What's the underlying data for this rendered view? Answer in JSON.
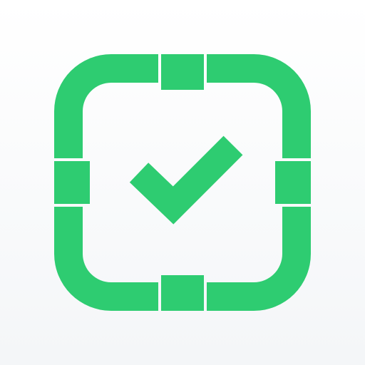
{
  "icon": {
    "name": "verified-checkbox-app-icon",
    "accent_color": "#2ECC71",
    "background_top": "#FFFFFF",
    "background_bottom": "#F4F6F8",
    "glyphs": [
      "rounded-square-frame-icon",
      "checkmark-icon"
    ]
  }
}
